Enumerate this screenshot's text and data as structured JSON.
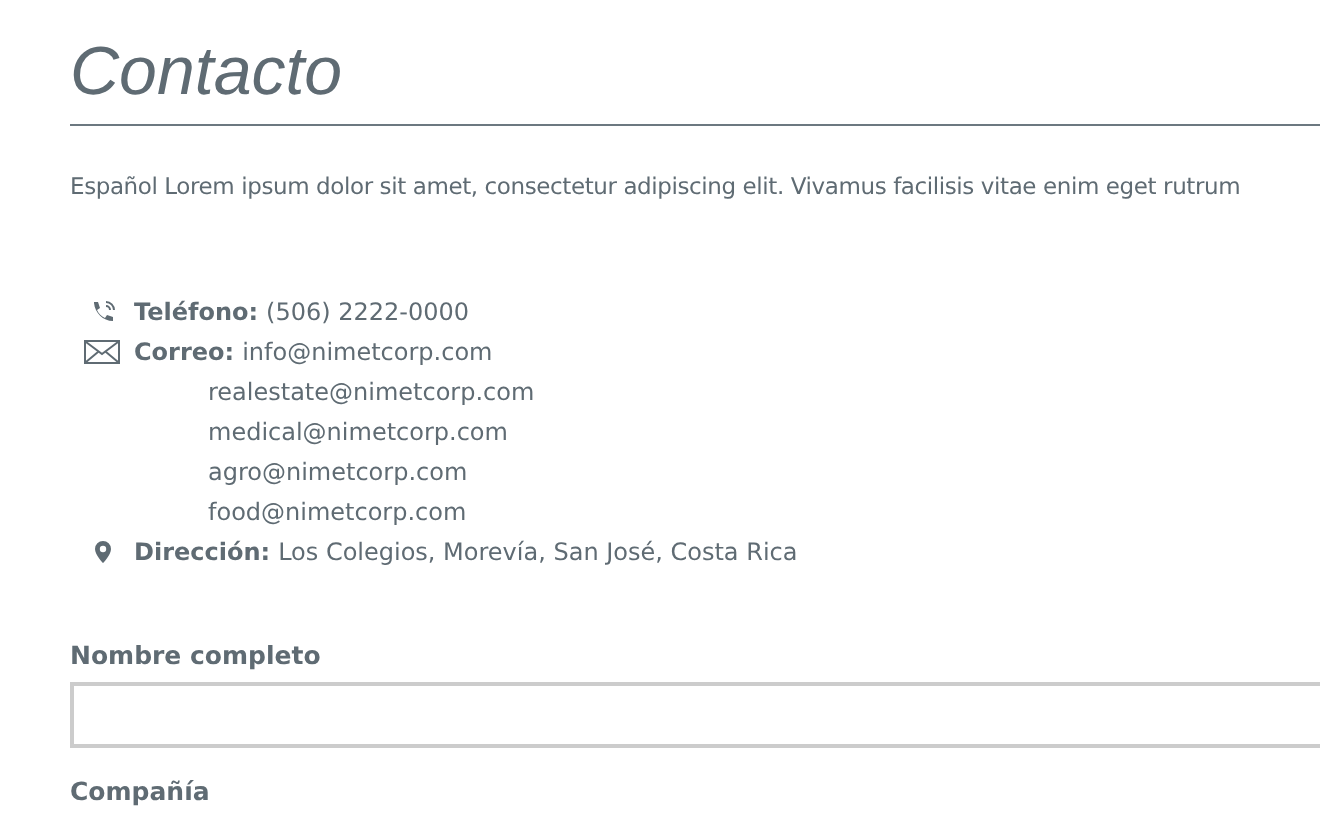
{
  "title": "Contacto",
  "intro": "Español Lorem ipsum dolor sit amet, consectetur adipiscing elit. Vivamus facilisis vitae enim eget rutrum",
  "contact": [
    {
      "kind": "phone",
      "label": "Teléfono:",
      "values": [
        "(506) 2222-0000"
      ]
    },
    {
      "kind": "email",
      "label": "Correo:",
      "values": [
        "info@nimetcorp.com",
        "realestate@nimetcorp.com",
        "medical@nimetcorp.com",
        "agro@nimetcorp.com",
        "food@nimetcorp.com"
      ]
    },
    {
      "kind": "address",
      "label": "Dirección:",
      "values": [
        "Los Colegios, Morevía, San José, Costa Rica"
      ]
    }
  ],
  "form": [
    {
      "label": "Nombre completo",
      "kind": "text_field"
    },
    {
      "label": "Compañía",
      "kind": "label"
    }
  ]
}
